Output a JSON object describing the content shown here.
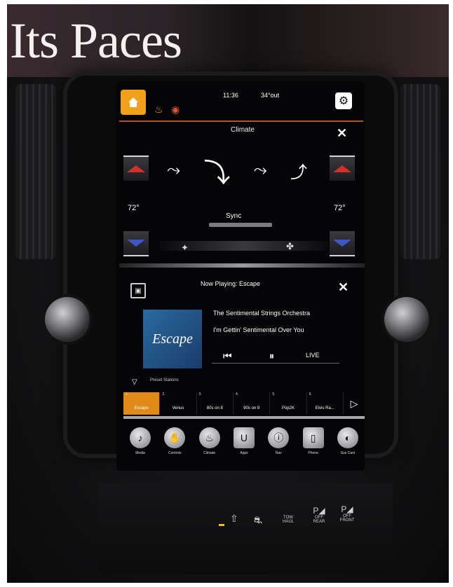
{
  "header": {
    "headline": "Its Paces"
  },
  "status_bar": {
    "time": "11:36",
    "outside_temp": "34°out"
  },
  "climate": {
    "title": "Climate",
    "left_temp": "72°",
    "right_temp": "72°",
    "sync_label": "Sync"
  },
  "media": {
    "now_playing": "Now Playing: Escape",
    "album_art_text": "Escape",
    "artist": "The Sentimental Strings Orchestra",
    "song": "I'm Gettin' Sentimental Over You",
    "live_label": "LIVE",
    "preset_header": "Preset Stations",
    "presets": [
      {
        "num": "1.",
        "label": "Escape",
        "active": true
      },
      {
        "num": "2.",
        "label": "Venus"
      },
      {
        "num": "3.",
        "label": "80s on 8"
      },
      {
        "num": "4.",
        "label": "90s on 9"
      },
      {
        "num": "5.",
        "label": "Pop2K"
      },
      {
        "num": "6.",
        "label": "Elvis Ra..."
      }
    ]
  },
  "dock": [
    {
      "label": "Media",
      "icon": "music-note-icon"
    },
    {
      "label": "Controls",
      "icon": "hand-icon"
    },
    {
      "label": "Climate",
      "icon": "seat-icon"
    },
    {
      "label": "Apps",
      "icon": "apps-icon"
    },
    {
      "label": "Nav",
      "icon": "nav-icon"
    },
    {
      "label": "Phone",
      "icon": "phone-icon"
    },
    {
      "label": "Sus Cam",
      "icon": "camera-icon"
    }
  ],
  "console": {
    "tow_haul": "TOW HAUL",
    "park_off_rear": "OFF REAR",
    "park_off_front": "OFF FRONT"
  },
  "colors": {
    "accent": "#f0a019",
    "preset_active": "#e08a1a",
    "heat": "#d2302a",
    "cool": "#3c58c8"
  }
}
